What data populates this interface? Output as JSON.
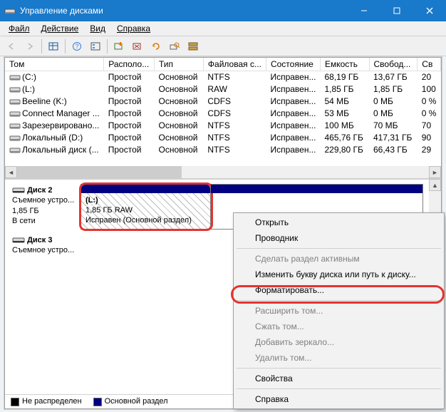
{
  "window": {
    "title": "Управление дисками"
  },
  "menu": {
    "file": "Файл",
    "action": "Действие",
    "view": "Вид",
    "help": "Справка"
  },
  "columns": {
    "vol": "Том",
    "layout": "Располо...",
    "type": "Тип",
    "fs": "Файловая с...",
    "status": "Состояние",
    "capacity": "Емкость",
    "free": "Свобод...",
    "pct": "Св"
  },
  "volumes": [
    {
      "name": "(C:)",
      "layout": "Простой",
      "type": "Основной",
      "fs": "NTFS",
      "status": "Исправен...",
      "cap": "68,19 ГБ",
      "free": "13,67 ГБ",
      "pct": "20"
    },
    {
      "name": "(L:)",
      "layout": "Простой",
      "type": "Основной",
      "fs": "RAW",
      "status": "Исправен...",
      "cap": "1,85 ГБ",
      "free": "1,85 ГБ",
      "pct": "100"
    },
    {
      "name": "Beeline (K:)",
      "layout": "Простой",
      "type": "Основной",
      "fs": "CDFS",
      "status": "Исправен...",
      "cap": "54 МБ",
      "free": "0 МБ",
      "pct": "0 %"
    },
    {
      "name": "Connect Manager ...",
      "layout": "Простой",
      "type": "Основной",
      "fs": "CDFS",
      "status": "Исправен...",
      "cap": "53 МБ",
      "free": "0 МБ",
      "pct": "0 %"
    },
    {
      "name": "Зарезервировано...",
      "layout": "Простой",
      "type": "Основной",
      "fs": "NTFS",
      "status": "Исправен...",
      "cap": "100 МБ",
      "free": "70 МБ",
      "pct": "70"
    },
    {
      "name": "Локальный (D:)",
      "layout": "Простой",
      "type": "Основной",
      "fs": "NTFS",
      "status": "Исправен...",
      "cap": "465,76 ГБ",
      "free": "417,31 ГБ",
      "pct": "90"
    },
    {
      "name": "Локальный диск (...",
      "layout": "Простой",
      "type": "Основной",
      "fs": "NTFS",
      "status": "Исправен...",
      "cap": "229,80 ГБ",
      "free": "66,43 ГБ",
      "pct": "29"
    }
  ],
  "disk2": {
    "label": "Диск 2",
    "line1": "Съемное устро...",
    "size": "1,85 ГБ",
    "state": "В сети",
    "part_name": "(L:)",
    "part_size": "1,85 ГБ RAW",
    "part_status": "Исправен (Основной раздел)"
  },
  "disk3": {
    "label": "Диск 3",
    "line1": "Съемное устро..."
  },
  "legend": {
    "unalloc": "Не распределен",
    "primary": "Основной раздел"
  },
  "ctx": {
    "open": "Открыть",
    "explorer": "Проводник",
    "make_active": "Сделать раздел активным",
    "change_letter": "Изменить букву диска или путь к диску...",
    "format": "Форматировать...",
    "extend": "Расширить том...",
    "shrink": "Сжать том...",
    "mirror": "Добавить зеркало...",
    "delete": "Удалить том...",
    "props": "Свойства",
    "help": "Справка"
  }
}
